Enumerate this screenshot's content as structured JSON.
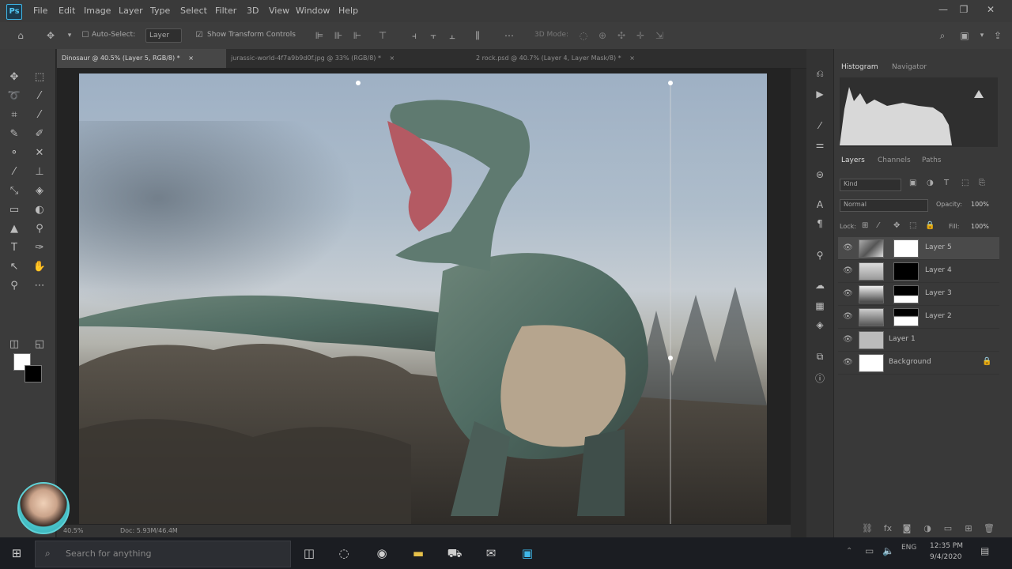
{
  "app": {
    "logo_text": "Ps"
  },
  "menubar": {
    "items": [
      "File",
      "Edit",
      "Image",
      "Layer",
      "Type",
      "Select",
      "Filter",
      "3D",
      "View",
      "Window",
      "Help"
    ],
    "window_controls": [
      "—",
      "❐",
      "✕"
    ]
  },
  "options": {
    "auto_select_label": "Auto-Select:",
    "auto_select_value": "Layer",
    "transform_controls_label": "Show Transform Controls",
    "mode_label": "3D Mode:"
  },
  "tabs": [
    {
      "label": "Dinosaur @ 40.5% (Layer 5, RGB/8) *",
      "close": "×"
    },
    {
      "label": "jurassic-world-4f7a9b9d0f.jpg @ 33% (RGB/8) *",
      "close": "×"
    },
    {
      "label": "2 rock.psd @ 40.7% (Layer 4, Layer Mask/8) *",
      "close": "×"
    }
  ],
  "status_bar": {
    "zoom": "40.5%",
    "doc": "Doc: 5.93M/46.4M"
  },
  "panels": {
    "top_tabs": [
      "Histogram",
      "Navigator"
    ],
    "layer_tabs": [
      "Layers",
      "Channels",
      "Paths"
    ],
    "kind_filter": "Kind",
    "blend_mode": "Normal",
    "opacity_label": "Opacity:",
    "opacity_value": "100%",
    "lock_label": "Lock:",
    "fill_label": "Fill:",
    "fill_value": "100%"
  },
  "layers": [
    {
      "name": "Layer 5",
      "selected": true
    },
    {
      "name": "Layer 4",
      "selected": false
    },
    {
      "name": "Layer 3",
      "selected": false
    },
    {
      "name": "Layer 2",
      "selected": false
    },
    {
      "name": "Layer 1",
      "selected": false
    },
    {
      "name": "Background",
      "selected": false
    }
  ],
  "taskbar": {
    "search_placeholder": "Search for anything",
    "time": "12:35 PM",
    "date": "9/4/2020"
  },
  "colors": {
    "accent": "#3fb7e8",
    "foreground": "#ffffff",
    "background": "#000000"
  }
}
